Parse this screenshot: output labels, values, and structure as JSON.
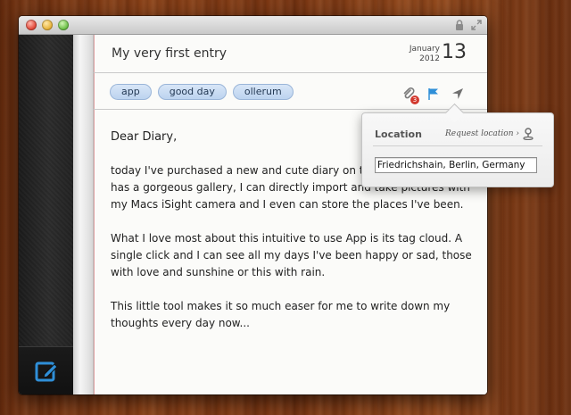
{
  "entry": {
    "title": "My very first entry",
    "date": {
      "month": "January",
      "year": "2012",
      "day": "13"
    },
    "tags": [
      "app",
      "good day",
      "ollerum"
    ],
    "attachment_count": "3"
  },
  "body": {
    "greeting": "Dear Diary,",
    "paragraphs": [
      "today I've purchased a new and cute diary on the Mac App Store. It has a gorgeous gallery, I can directly import and take pictures with my Macs iSight camera and I even can store the places I've been.",
      "What I love most about this intuitive to use App is its tag cloud. A single click and I can see all my days I've been happy or sad, those with love and sunshine or this with rain.",
      "This little tool makes it so much easer for me to write down my thoughts every day now..."
    ]
  },
  "location_popover": {
    "label": "Location",
    "request_link": "Request location ›",
    "value": "Friedrichshain, Berlin, Germany"
  },
  "icons": {
    "attachments": "paperclip-icon",
    "flag": "flag-icon",
    "location": "location-arrow-icon",
    "compose": "compose-icon",
    "lock": "lock-icon",
    "fullscreen": "fullscreen-icon",
    "pin": "map-pin-icon"
  },
  "colors": {
    "accent_blue": "#2f8fd8",
    "tag_bg": "#c9dcf3",
    "badge_red": "#d23a2f"
  }
}
